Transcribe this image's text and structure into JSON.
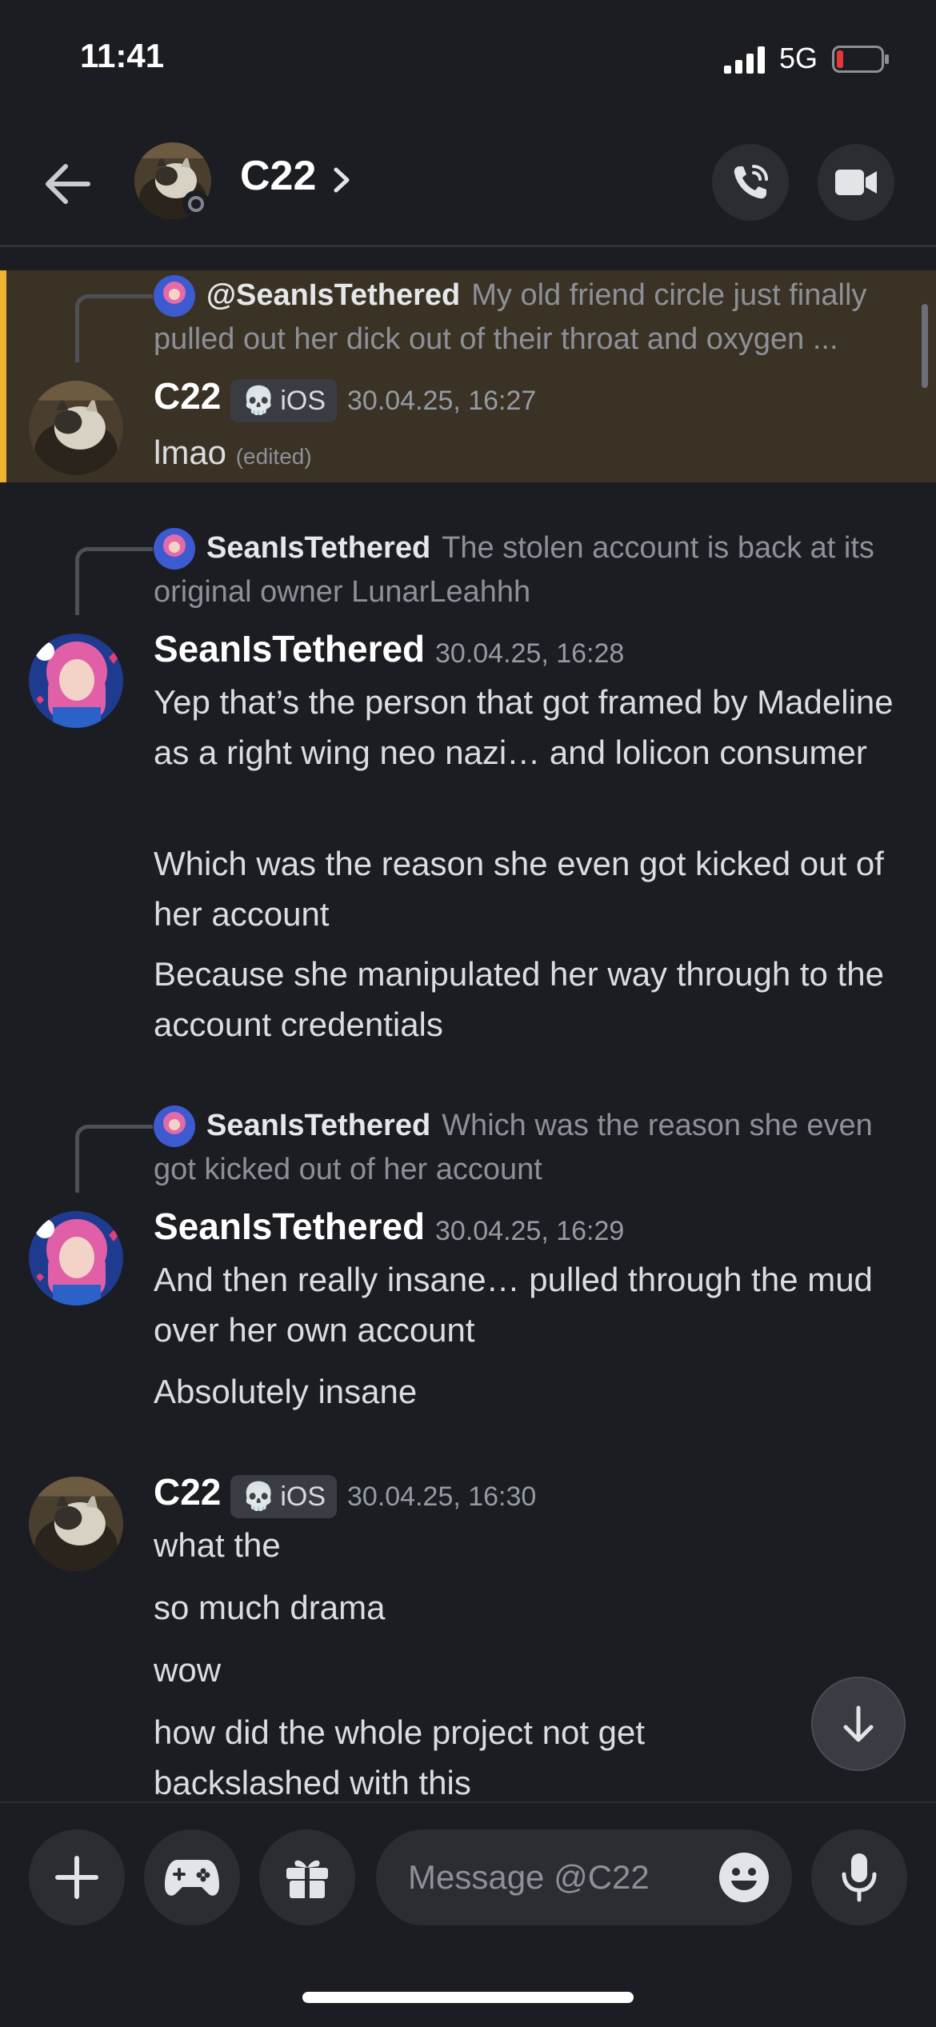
{
  "status_bar": {
    "time": "11:41",
    "network": "5G"
  },
  "header": {
    "title": "C22"
  },
  "messages": [
    {
      "reply_to": {
        "author": "@SeanIsTethered",
        "text": "My old friend circle just finally pulled out her dick out of their throat and oxygen ..."
      },
      "author": "C22",
      "tag": "iOS",
      "timestamp": "30.04.25, 16:27",
      "lines": [
        "lmao"
      ],
      "edited": "(edited)"
    },
    {
      "reply_to": {
        "author": "SeanIsTethered",
        "text": "The stolen account is back at its original owner LunarLeahhh"
      },
      "author": "SeanIsTethered",
      "timestamp": "30.04.25, 16:28",
      "lines": [
        "Yep that’s the person that got framed by Madeline as a right wing neo nazi… and lolicon consumer",
        "Which was the reason she even got kicked out of her account",
        "Because she manipulated her way through to the account credentials"
      ]
    },
    {
      "reply_to": {
        "author": "SeanIsTethered",
        "text": "Which was the reason she even got kicked out of her account"
      },
      "author": "SeanIsTethered",
      "timestamp": "30.04.25, 16:29",
      "lines": [
        "And then really insane… pulled through the mud over her own account",
        "Absolutely insane"
      ]
    },
    {
      "author": "C22",
      "tag": "iOS",
      "timestamp": "30.04.25, 16:30",
      "lines": [
        "what the",
        "so much drama",
        "wow",
        "how did the whole project not get backslashed with this"
      ]
    }
  ],
  "composer": {
    "placeholder": "Message @C22"
  },
  "icons": {
    "back": "arrow-left-icon",
    "chevron": "chevron-right-icon",
    "call": "phone-call-icon",
    "video": "video-camera-icon",
    "skull": "skull-icon",
    "jump": "arrow-down-icon",
    "plus": "plus-icon",
    "game": "gamepad-icon",
    "gift": "gift-icon",
    "emoji": "emoji-icon",
    "mic": "microphone-icon"
  },
  "colors": {
    "background": "#1c1d22",
    "highlight": "#3a3325",
    "highlight_bar": "#f0b232",
    "battery_low": "#e5383b"
  }
}
